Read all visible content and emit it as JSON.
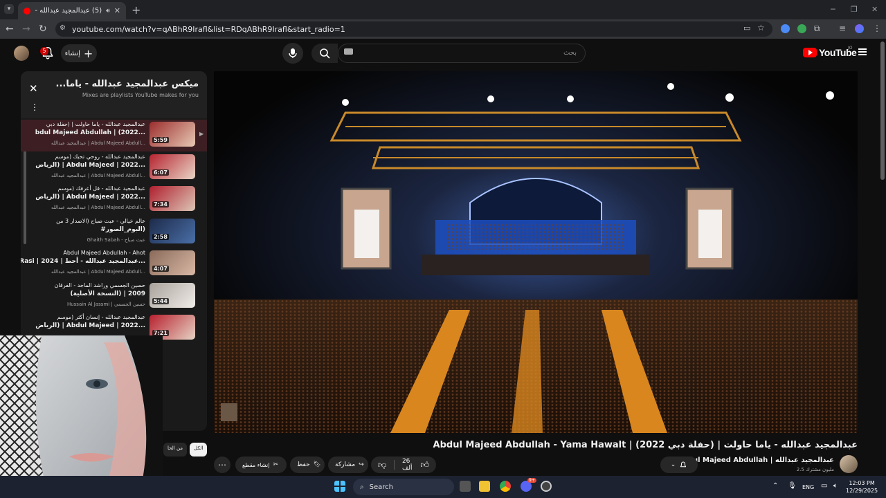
{
  "browser": {
    "tab_title": "(5) عبدالمجيد عبدالله - ياما حا",
    "url": "youtube.com/watch?v=qABhR9Irafl&list=RDqABhR9Irafl&start_radio=1"
  },
  "header": {
    "create_label": "إنشاء",
    "notification_count": "5",
    "search_placeholder": "بحث",
    "logo_text": "YouTube",
    "logo_suffix": "JO"
  },
  "playlist": {
    "title": "ميكس عبدالمجيد عبدالله - ياما...",
    "subtitle": "Mixes are playlists YouTube makes for you",
    "items": [
      {
        "line1": "عبدالمجيد عبدالله - ياما حاولت | (حفلة دبي",
        "line2": "bdul Majeed Abdullah | (2022...",
        "channel": "عبدالمجيد عبدالله | Abdul Majeed Abdull...",
        "duration": "5:59",
        "thumb_a": "#9b2d2d",
        "thumb_b": "#e7c9b4"
      },
      {
        "line1": "عبدالمجيد عبدالله - روحي تحبك (موسم",
        "line2": "الرياض) | Abdul Majeed | 2022...",
        "channel": "عبدالمجيد عبدالله | Abdul Majeed Abdull...",
        "duration": "6:07",
        "thumb_a": "#b62330",
        "thumb_b": "#e8d6c6"
      },
      {
        "line1": "عبدالمجيد عبدالله - قل أعرفك (موسم",
        "line2": "الرياض) | Abdul Majeed | 2022...",
        "channel": "عبدالمجيد عبدالله | Abdul Majeed Abdull...",
        "duration": "7:34",
        "thumb_a": "#b01f2e",
        "thumb_b": "#dcc6b6"
      },
      {
        "line1": "عالم خيالي - عبث صباح (الاصدار 3 من",
        "line2": "#البوم_الصور)",
        "channel": "Ghaith Sabah - عبث صباح",
        "duration": "2:58",
        "thumb_a": "#1d2b4a",
        "thumb_b": "#4a6fa8"
      },
      {
        "line1": "Abdul Majeed Abdullah - Ahot",
        "line2": "Rasi | 2024 | عبدالمجيد عبدالله - أحط...",
        "channel": "عبدالمجيد عبدالله | Abdul Majeed Abdull...",
        "duration": "4:07",
        "thumb_a": "#8a6a5a",
        "thumb_b": "#d9b8a5"
      },
      {
        "line1": "حسين الجسمي وراشد الماجد - الفرقان",
        "line2": "(النسخة الأصلية) | 2009",
        "channel": "Hussain Al Jassmi | حسين الجسمي",
        "duration": "5:44",
        "thumb_a": "#a9a29b",
        "thumb_b": "#f0ece8"
      },
      {
        "line1": "عبدالمجيد عبدالله - إنسان أكثر (موسم",
        "line2": "الرياض) | Abdul Majeed | 2022...",
        "channel": "",
        "duration": "7:21",
        "thumb_a": "#b7202e",
        "thumb_b": "#e6d3c4"
      }
    ]
  },
  "video": {
    "title": "عبدالمجيد عبدالله - ياما حاولت | (حفلة دبي 2022) | Abdul Majeed Abdullah - Yama Hawalt",
    "channel_name": "عبدالمجيد عبدالله | Abdul Majeed Abdullah",
    "channel_subs": "2.5 مليون مشترك",
    "likes": "26 ألف",
    "share_label": "مشاركة",
    "save_label": "حفظ",
    "clip_label": "إنشاء مقطع"
  },
  "filters": {
    "all": "الكل",
    "from_channel": "من الحا"
  },
  "taskbar": {
    "search_label": "Search",
    "lang": "ENG",
    "time": "12:03 PM",
    "date": "12/29/2025",
    "discord_badge": "9+"
  },
  "icons": {
    "back": "back-arrow-icon",
    "forward": "forward-arrow-icon",
    "reload": "reload-icon"
  },
  "colors": {
    "yt_red": "#ff0000",
    "bg": "#0f0f0f",
    "active_item": "#3d1f23"
  }
}
